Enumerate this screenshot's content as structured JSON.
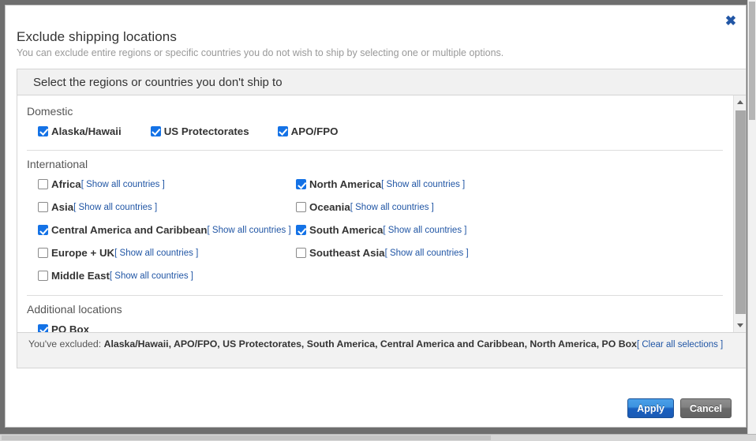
{
  "dialog": {
    "title": "Exclude shipping locations",
    "subtitle": "You can exclude entire regions or specific countries you do not wish to ship by selecting one or multiple options.",
    "close_label": "✖"
  },
  "panel": {
    "header_title": "Select the regions or countries you don't ship to"
  },
  "groups": {
    "domestic": {
      "title": "Domestic",
      "items": [
        {
          "label": "Alaska/Hawaii",
          "checked": true
        },
        {
          "label": "US Protectorates",
          "checked": true
        },
        {
          "label": "APO/FPO",
          "checked": true
        }
      ]
    },
    "international": {
      "title": "International",
      "show_all_label": "[ Show all countries ]",
      "left": [
        {
          "label": "Africa",
          "checked": false
        },
        {
          "label": "Asia",
          "checked": false
        },
        {
          "label": "Central America and Caribbean",
          "checked": true
        },
        {
          "label": "Europe + UK",
          "checked": false
        },
        {
          "label": "Middle East",
          "checked": false
        }
      ],
      "right": [
        {
          "label": "North America",
          "checked": true
        },
        {
          "label": "Oceania",
          "checked": false
        },
        {
          "label": "South America",
          "checked": true
        },
        {
          "label": "Southeast Asia",
          "checked": false
        }
      ]
    },
    "additional": {
      "title": "Additional locations",
      "items": [
        {
          "label": "PO Box",
          "checked": true
        }
      ]
    }
  },
  "summary": {
    "prefix": "You've excluded: ",
    "excluded_list": "Alaska/Hawaii, APO/FPO, US Protectorates, South America, Central America and Caribbean, North America, PO Box",
    "clear_all_label": "[ Clear all selections ]"
  },
  "footer": {
    "apply_label": "Apply",
    "cancel_label": "Cancel"
  },
  "colors": {
    "accent_blue": "#1472e6",
    "link_blue": "#2156a5",
    "apply_button": "#1960c0",
    "cancel_button": "#6a6a6a"
  }
}
